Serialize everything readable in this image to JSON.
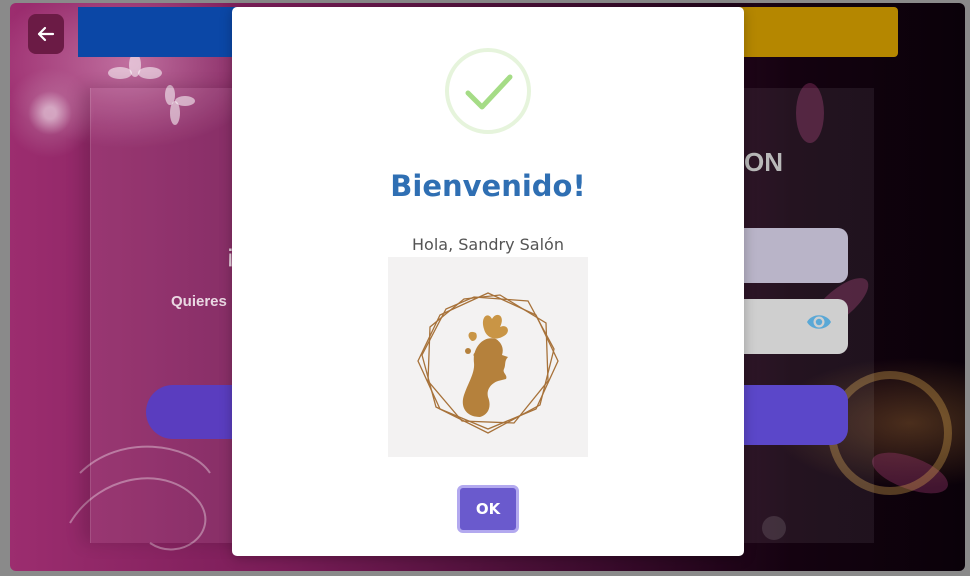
{
  "background": {
    "back_icon": "arrow-left-icon",
    "left_card_char": "¡",
    "left_card_text": "Quieres",
    "right_card_title": "ON",
    "password_toggle_icon": "eye-icon"
  },
  "modal": {
    "icon": "checkmark-icon",
    "title": "Bienvenido!",
    "greeting": "Hola, Sandry Salón",
    "image": "salon-logo-woman-silhouette",
    "ok_label": "OK"
  },
  "colors": {
    "title": "#2f6fb3",
    "ok_button": "#6a5acd",
    "success_check": "#a5dc86",
    "top_bar_blue": "#0b47a6",
    "top_bar_gold": "#b58700"
  }
}
